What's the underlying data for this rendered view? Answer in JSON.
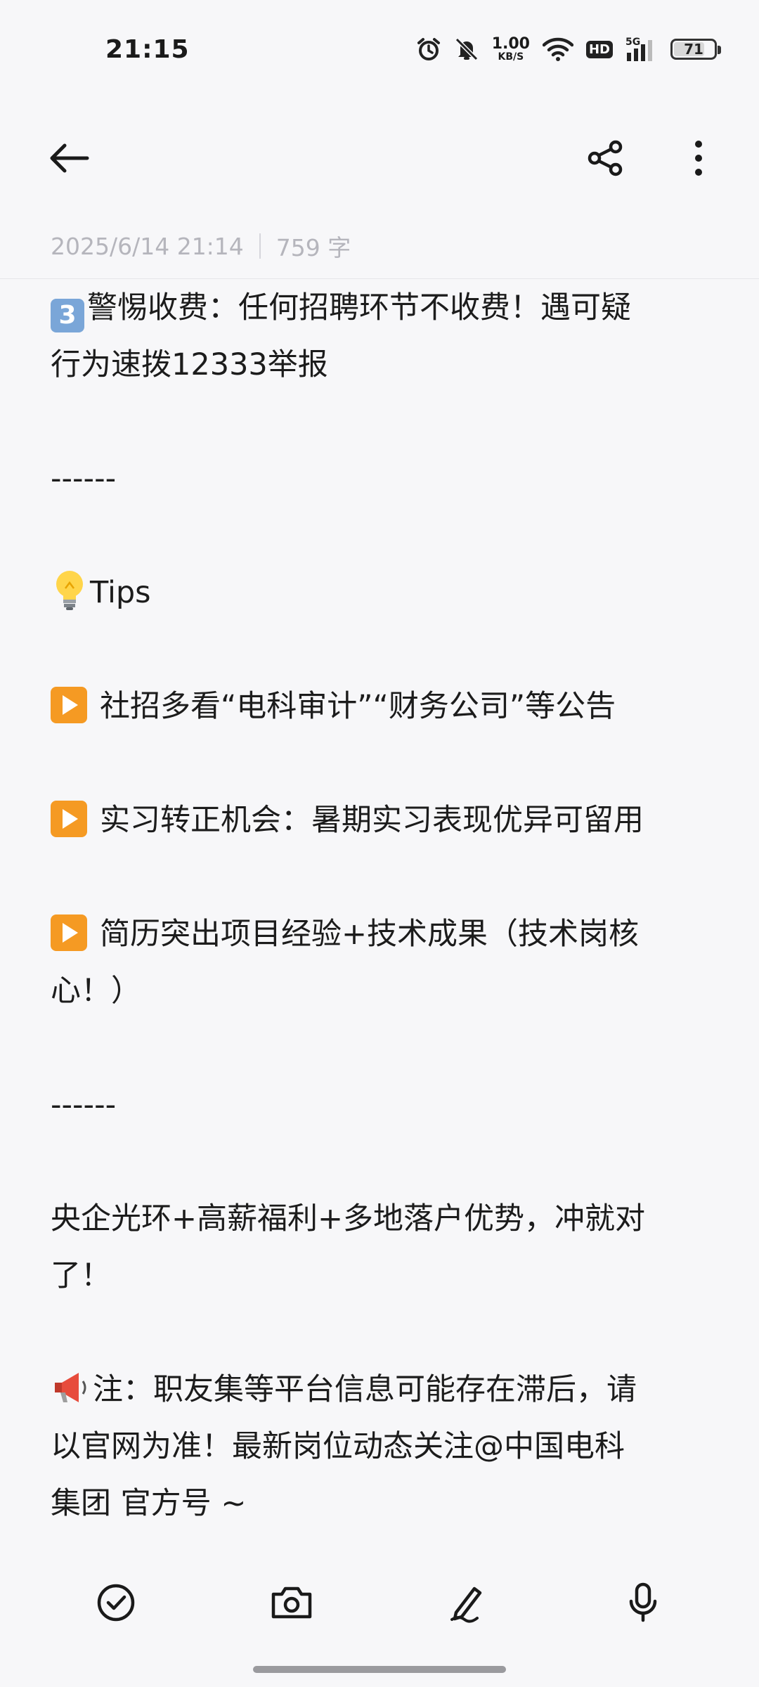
{
  "status_bar": {
    "time": "21:15",
    "net_speed_value": "1.00",
    "net_speed_unit": "KB/S",
    "hd": "HD",
    "signal": "5G",
    "battery": "71",
    "battery_level_percent": 71
  },
  "toolbar": {
    "back_icon": "back-arrow-icon",
    "share_icon": "share-icon",
    "more_icon": "more-vertical-icon"
  },
  "meta": {
    "date": "2025/6/14 21:14",
    "word_count": "759 字"
  },
  "note": {
    "line1_key": "3",
    "line1": "警惕收费：任何招聘环节不收费！遇可疑",
    "line2": "行为速拨12333举报",
    "sep1": "------",
    "tips": "Tips",
    "tip1": "社招多看“电科审计”“财务公司”等公告",
    "tip2": "实习转正机会：暑期实习表现优异可留用",
    "tip3a": "简历突出项目经验+技术成果（技术岗核",
    "tip3b": "心！）",
    "sep2": "------",
    "closing_a": "央企光环+高薪福利+多地落户优势，冲就对",
    "closing_b": "了！",
    "note_a": "注：职友集等平台信息可能存在滞后，请",
    "note_b": "以官网为准！最新岗位动态关注@中国电科",
    "note_c": "集团 官方号 ~"
  },
  "bottom_bar": {
    "check_icon": "checklist-icon",
    "camera_icon": "camera-icon",
    "pen_icon": "handwriting-icon",
    "mic_icon": "microphone-icon"
  },
  "colors": {
    "background": "#f7f7f9",
    "text": "#1c1c1c",
    "meta_text": "#b5b5bc",
    "play_emoji": "#f59a23",
    "keycap_emoji": "#7aa6d8"
  }
}
